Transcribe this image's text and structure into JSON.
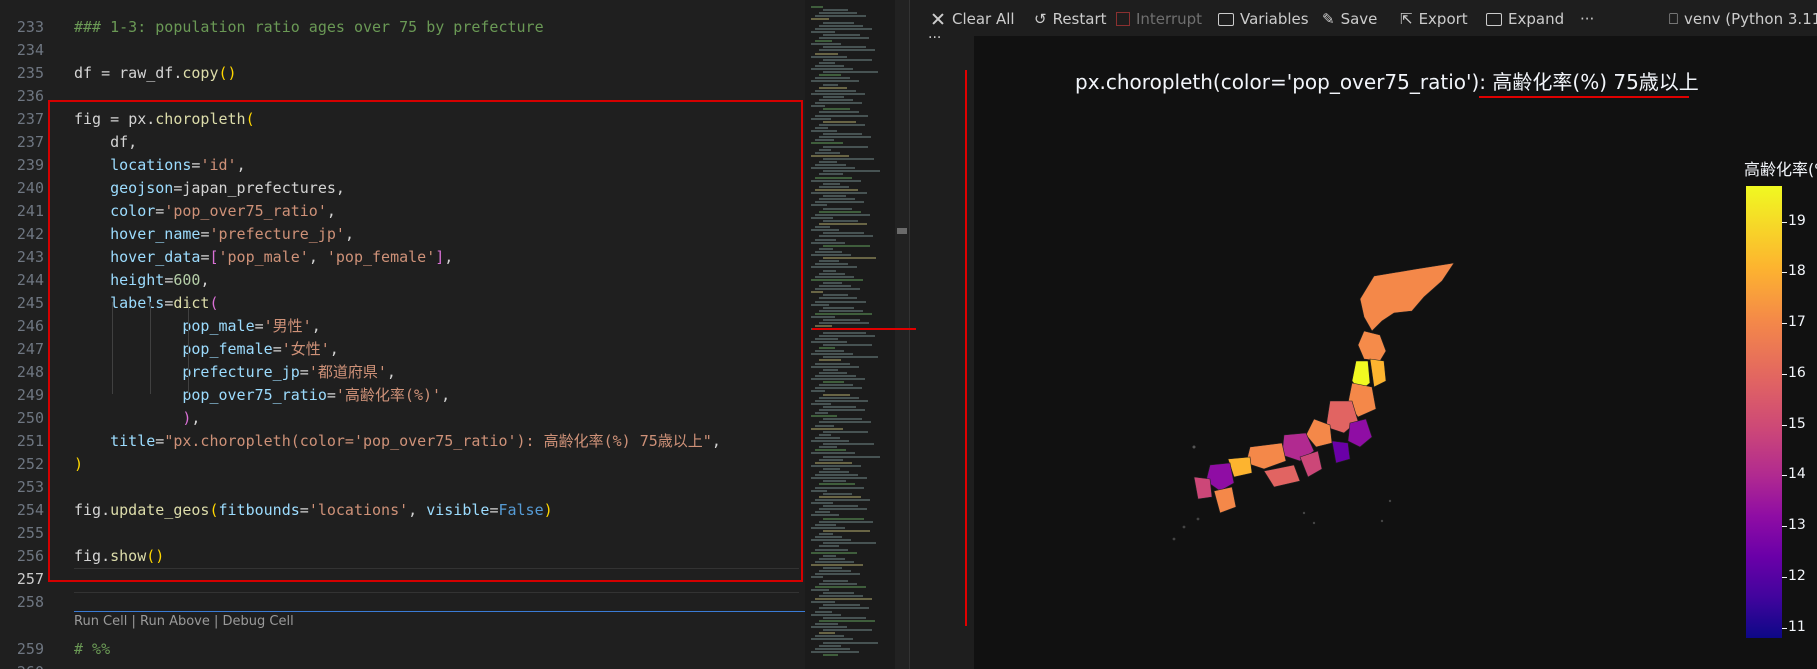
{
  "editor": {
    "lines": [
      {
        "num": "233",
        "tokens": [
          {
            "t": "### 1-3: population ratio ages over 75 by prefecture",
            "c": "c-comment"
          }
        ]
      },
      {
        "num": "234",
        "tokens": []
      },
      {
        "num": "235",
        "tokens": [
          {
            "t": "df",
            "c": "c-pun"
          },
          {
            "t": " = ",
            "c": "c-pun"
          },
          {
            "t": "raw_df",
            "c": "c-pun"
          },
          {
            "t": ".",
            "c": "c-pun"
          },
          {
            "t": "copy",
            "c": "c-fn"
          },
          {
            "t": "()",
            "c": "c-br1"
          }
        ]
      },
      {
        "num": "236",
        "tokens": []
      },
      {
        "num": "237",
        "tokens": [
          {
            "t": "fig",
            "c": "c-pun"
          },
          {
            "t": " = ",
            "c": "c-pun"
          },
          {
            "t": "px",
            "c": "c-pun"
          },
          {
            "t": ".",
            "c": "c-pun"
          },
          {
            "t": "choropleth",
            "c": "c-fn"
          },
          {
            "t": "(",
            "c": "c-br1"
          }
        ]
      },
      {
        "num": "237",
        "tokens": [
          {
            "t": "    df,",
            "c": "c-pun"
          }
        ]
      },
      {
        "num": "239",
        "tokens": [
          {
            "t": "    locations",
            "c": "c-var"
          },
          {
            "t": "=",
            "c": "c-pun"
          },
          {
            "t": "'id'",
            "c": "c-str"
          },
          {
            "t": ",",
            "c": "c-pun"
          }
        ]
      },
      {
        "num": "240",
        "tokens": [
          {
            "t": "    geojson",
            "c": "c-var"
          },
          {
            "t": "=",
            "c": "c-pun"
          },
          {
            "t": "japan_prefectures",
            "c": "c-pun"
          },
          {
            "t": ",",
            "c": "c-pun"
          }
        ]
      },
      {
        "num": "241",
        "tokens": [
          {
            "t": "    color",
            "c": "c-var"
          },
          {
            "t": "=",
            "c": "c-pun"
          },
          {
            "t": "'pop_over75_ratio'",
            "c": "c-str"
          },
          {
            "t": ",",
            "c": "c-pun"
          }
        ]
      },
      {
        "num": "242",
        "tokens": [
          {
            "t": "    hover_name",
            "c": "c-var"
          },
          {
            "t": "=",
            "c": "c-pun"
          },
          {
            "t": "'prefecture_jp'",
            "c": "c-str"
          },
          {
            "t": ",",
            "c": "c-pun"
          }
        ]
      },
      {
        "num": "243",
        "tokens": [
          {
            "t": "    hover_data",
            "c": "c-var"
          },
          {
            "t": "=",
            "c": "c-pun"
          },
          {
            "t": "[",
            "c": "c-br2"
          },
          {
            "t": "'pop_male'",
            "c": "c-str"
          },
          {
            "t": ", ",
            "c": "c-pun"
          },
          {
            "t": "'pop_female'",
            "c": "c-str"
          },
          {
            "t": "]",
            "c": "c-br2"
          },
          {
            "t": ",",
            "c": "c-pun"
          }
        ]
      },
      {
        "num": "244",
        "tokens": [
          {
            "t": "    height",
            "c": "c-var"
          },
          {
            "t": "=",
            "c": "c-pun"
          },
          {
            "t": "600",
            "c": "c-num"
          },
          {
            "t": ",",
            "c": "c-pun"
          }
        ]
      },
      {
        "num": "245",
        "tokens": [
          {
            "t": "    labels",
            "c": "c-var"
          },
          {
            "t": "=",
            "c": "c-pun"
          },
          {
            "t": "dict",
            "c": "c-fn"
          },
          {
            "t": "(",
            "c": "c-br2"
          }
        ]
      },
      {
        "num": "246",
        "tokens": [
          {
            "t": "            pop_male",
            "c": "c-var"
          },
          {
            "t": "=",
            "c": "c-pun"
          },
          {
            "t": "'男性'",
            "c": "c-str"
          },
          {
            "t": ",",
            "c": "c-pun"
          }
        ]
      },
      {
        "num": "247",
        "tokens": [
          {
            "t": "            pop_female",
            "c": "c-var"
          },
          {
            "t": "=",
            "c": "c-pun"
          },
          {
            "t": "'女性'",
            "c": "c-str"
          },
          {
            "t": ",",
            "c": "c-pun"
          }
        ]
      },
      {
        "num": "248",
        "tokens": [
          {
            "t": "            prefecture_jp",
            "c": "c-var"
          },
          {
            "t": "=",
            "c": "c-pun"
          },
          {
            "t": "'都道府県'",
            "c": "c-str"
          },
          {
            "t": ",",
            "c": "c-pun"
          }
        ]
      },
      {
        "num": "249",
        "tokens": [
          {
            "t": "            pop_over75_ratio",
            "c": "c-var"
          },
          {
            "t": "=",
            "c": "c-pun"
          },
          {
            "t": "'高齢化率(%)'",
            "c": "c-str"
          },
          {
            "t": ",",
            "c": "c-pun"
          }
        ]
      },
      {
        "num": "250",
        "tokens": [
          {
            "t": "            ",
            "c": "c-pun"
          },
          {
            "t": ")",
            "c": "c-br2"
          },
          {
            "t": ",",
            "c": "c-pun"
          }
        ]
      },
      {
        "num": "251",
        "tokens": [
          {
            "t": "    title",
            "c": "c-var"
          },
          {
            "t": "=",
            "c": "c-pun"
          },
          {
            "t": "\"px.choropleth(color='pop_over75_ratio'): 高齢化率(%) 75歳以上\"",
            "c": "c-str"
          },
          {
            "t": ",",
            "c": "c-pun"
          }
        ]
      },
      {
        "num": "252",
        "tokens": [
          {
            "t": ")",
            "c": "c-br1"
          }
        ]
      },
      {
        "num": "253",
        "tokens": []
      },
      {
        "num": "254",
        "tokens": [
          {
            "t": "fig",
            "c": "c-pun"
          },
          {
            "t": ".",
            "c": "c-pun"
          },
          {
            "t": "update_geos",
            "c": "c-fn"
          },
          {
            "t": "(",
            "c": "c-br1"
          },
          {
            "t": "fitbounds",
            "c": "c-var"
          },
          {
            "t": "=",
            "c": "c-pun"
          },
          {
            "t": "'locations'",
            "c": "c-str"
          },
          {
            "t": ", ",
            "c": "c-pun"
          },
          {
            "t": "visible",
            "c": "c-var"
          },
          {
            "t": "=",
            "c": "c-pun"
          },
          {
            "t": "False",
            "c": "c-kw"
          },
          {
            "t": ")",
            "c": "c-br1"
          }
        ]
      },
      {
        "num": "255",
        "tokens": []
      },
      {
        "num": "256",
        "tokens": [
          {
            "t": "fig",
            "c": "c-pun"
          },
          {
            "t": ".",
            "c": "c-pun"
          },
          {
            "t": "show",
            "c": "c-fn"
          },
          {
            "t": "()",
            "c": "c-br1"
          }
        ]
      },
      {
        "num": "257",
        "tokens": [],
        "active": true
      },
      {
        "num": "258",
        "tokens": []
      },
      {
        "num": "259",
        "tokens": [
          {
            "t": "# %%",
            "c": "c-comment"
          }
        ]
      },
      {
        "num": "260",
        "tokens": []
      }
    ],
    "codelens": "Run Cell | Run Above | Debug Cell"
  },
  "toolbar": {
    "clear_all": "Clear All",
    "restart": "Restart",
    "interrupt": "Interrupt",
    "variables": "Variables",
    "save": "Save",
    "export": "Export",
    "expand": "Expand",
    "more": "···",
    "kernel": "venv (Python 3.11"
  },
  "output": {
    "more": "···",
    "title_main": "px.choropleth(color='pop_over75_ratio'): ",
    "title_jp": "高齢化率(%) 75歳以上",
    "colorbar_title": "高齢化率(%)",
    "colorbar_ticks": [
      "19",
      "18",
      "17",
      "16",
      "15",
      "14",
      "13",
      "12",
      "11"
    ]
  },
  "chart_data": {
    "type": "heatmap",
    "title": "px.choropleth(color='pop_over75_ratio'): 高齢化率(%) 75歳以上",
    "colorbar_title": "高齢化率(%)",
    "color_range": [
      10.8,
      19.7
    ],
    "colorbar_ticks": [
      11,
      12,
      13,
      14,
      15,
      16,
      17,
      18,
      19
    ],
    "colorscale": "plasma",
    "legend_placement": "right",
    "grid": false
  }
}
